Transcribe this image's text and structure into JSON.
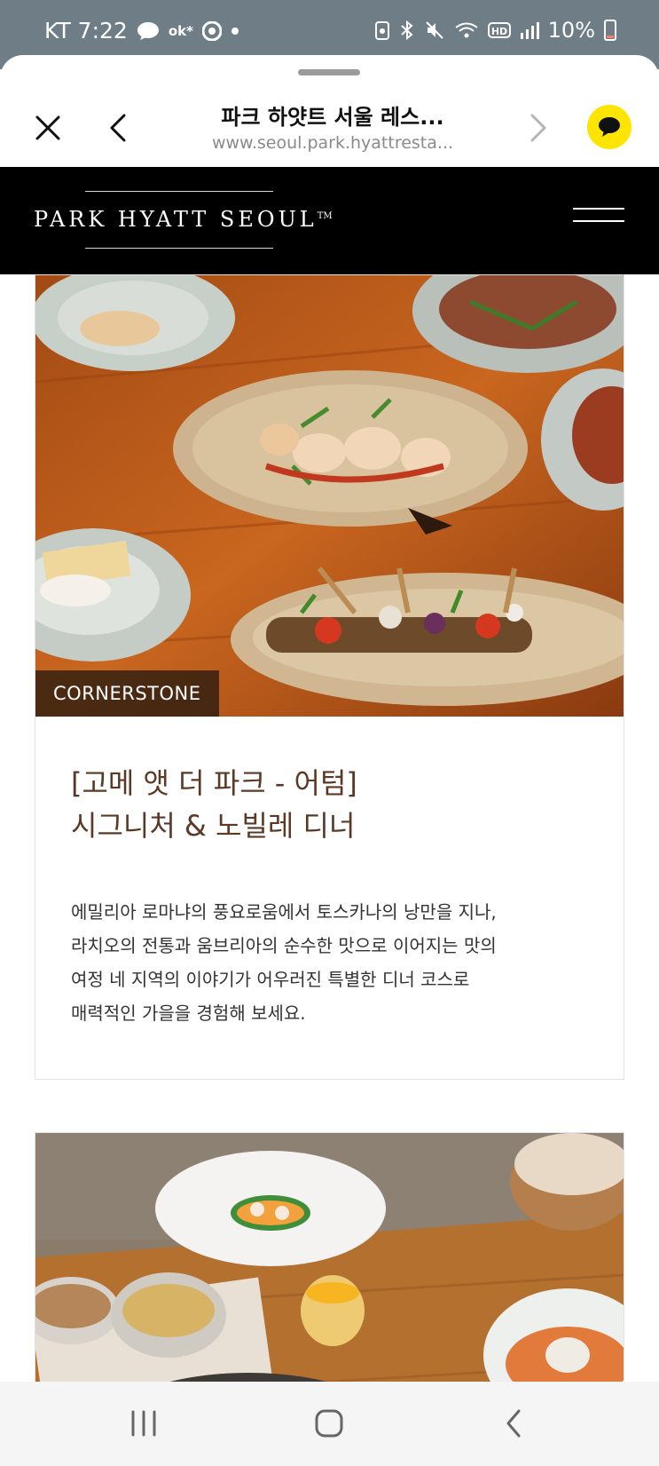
{
  "status_bar": {
    "carrier_time": "KT 7:22",
    "ok_label": "ok*",
    "battery": "10%",
    "icons": [
      "chat-bubble-icon",
      "ok-icon",
      "chrome-icon",
      "dot-icon",
      "saver-icon",
      "bluetooth-icon",
      "mute-icon",
      "wifi-icon",
      "hd-icon",
      "signal-icon",
      "battery-icon"
    ]
  },
  "browser_toolbar": {
    "title": "파크 하얏트 서울 레스...",
    "url": "www.seoul.park.hyattresta...",
    "buttons": [
      "close-icon",
      "back-icon",
      "forward-icon",
      "kakao-chat-icon"
    ]
  },
  "site_header": {
    "logo": "PARK HYATT SEOUL",
    "trademark": "TM",
    "menu_icon": "hamburger-icon"
  },
  "cards": [
    {
      "badge": "CORNERSTONE",
      "title_line1": "[고메 앳 더 파크 - 어텀]",
      "title_line2": "시그니처 & 노빌레 디너",
      "desc_line1": "에밀리아 로마냐의 풍요로움에서 토스카나의 낭만을 지나,",
      "desc_line2": "라치오의 전통과 움브리아의 순수한 맛으로 이어지는 맛의",
      "desc_line3": "여정 네 지역의 이야기가 어우러진 특별한 디너 코스로",
      "desc_line4": "매력적인 가을을 경험해 보세요."
    }
  ],
  "nav_bar": {
    "buttons": [
      "recents-icon",
      "home-icon",
      "back-icon"
    ]
  }
}
